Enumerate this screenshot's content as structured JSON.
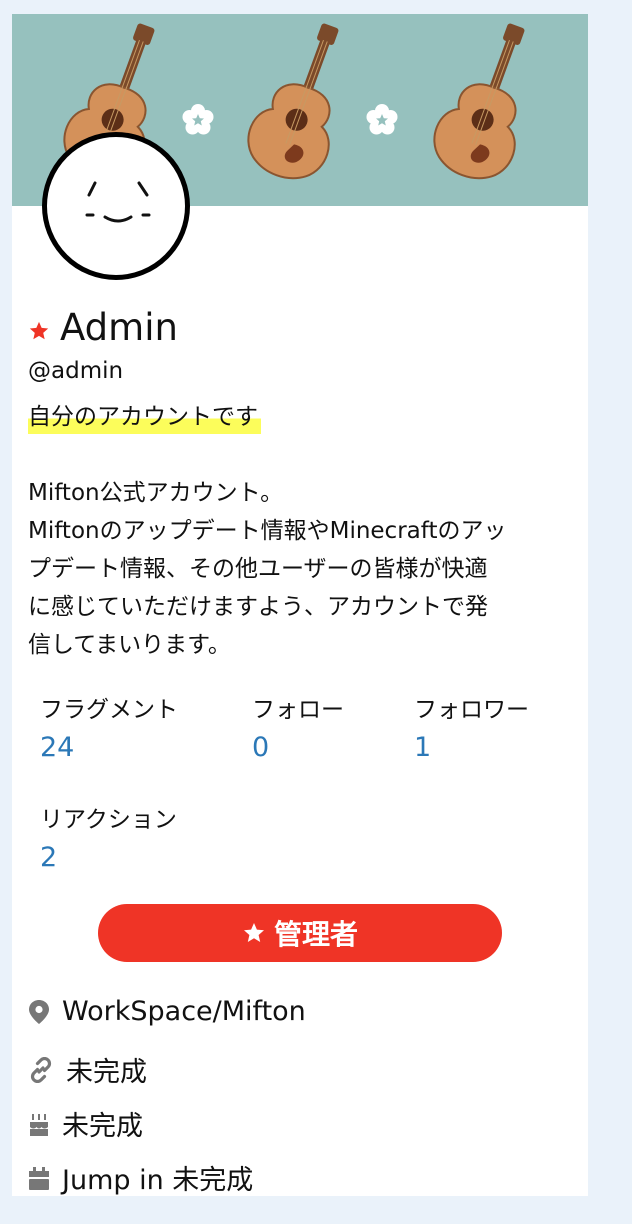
{
  "profile": {
    "display_name": "Admin",
    "handle": "@admin",
    "note": "自分のアカウントです",
    "bio_lines": [
      "Mifton公式アカウント。",
      "Miftonのアップデート情報やMinecraftのアッ",
      "プデート情報、その他ユーザーの皆様が快適",
      "に感じていただけますよう、アカウントで発",
      "信してまいります。"
    ]
  },
  "stats": {
    "fragments": {
      "label": "フラグメント",
      "value": "24"
    },
    "following": {
      "label": "フォロー",
      "value": "0"
    },
    "followers": {
      "label": "フォロワー",
      "value": "1"
    },
    "reactions": {
      "label": "リアクション",
      "value": "2"
    }
  },
  "role_badge": {
    "label": "管理者",
    "color": "#ef3426"
  },
  "info": {
    "location": "WorkSpace/Mifton",
    "website": "未完成",
    "birthday": "未完成",
    "joined": "Jump in 未完成"
  },
  "icons": {
    "name_badge": "star-icon",
    "location": "map-pin-icon",
    "website": "link-icon",
    "birthday": "cake-icon",
    "joined": "calendar-icon"
  },
  "colors": {
    "banner": "#96c1be",
    "accent": "#2b78b7",
    "highlight": "#fcfd5b",
    "admin_red": "#ef3426"
  }
}
